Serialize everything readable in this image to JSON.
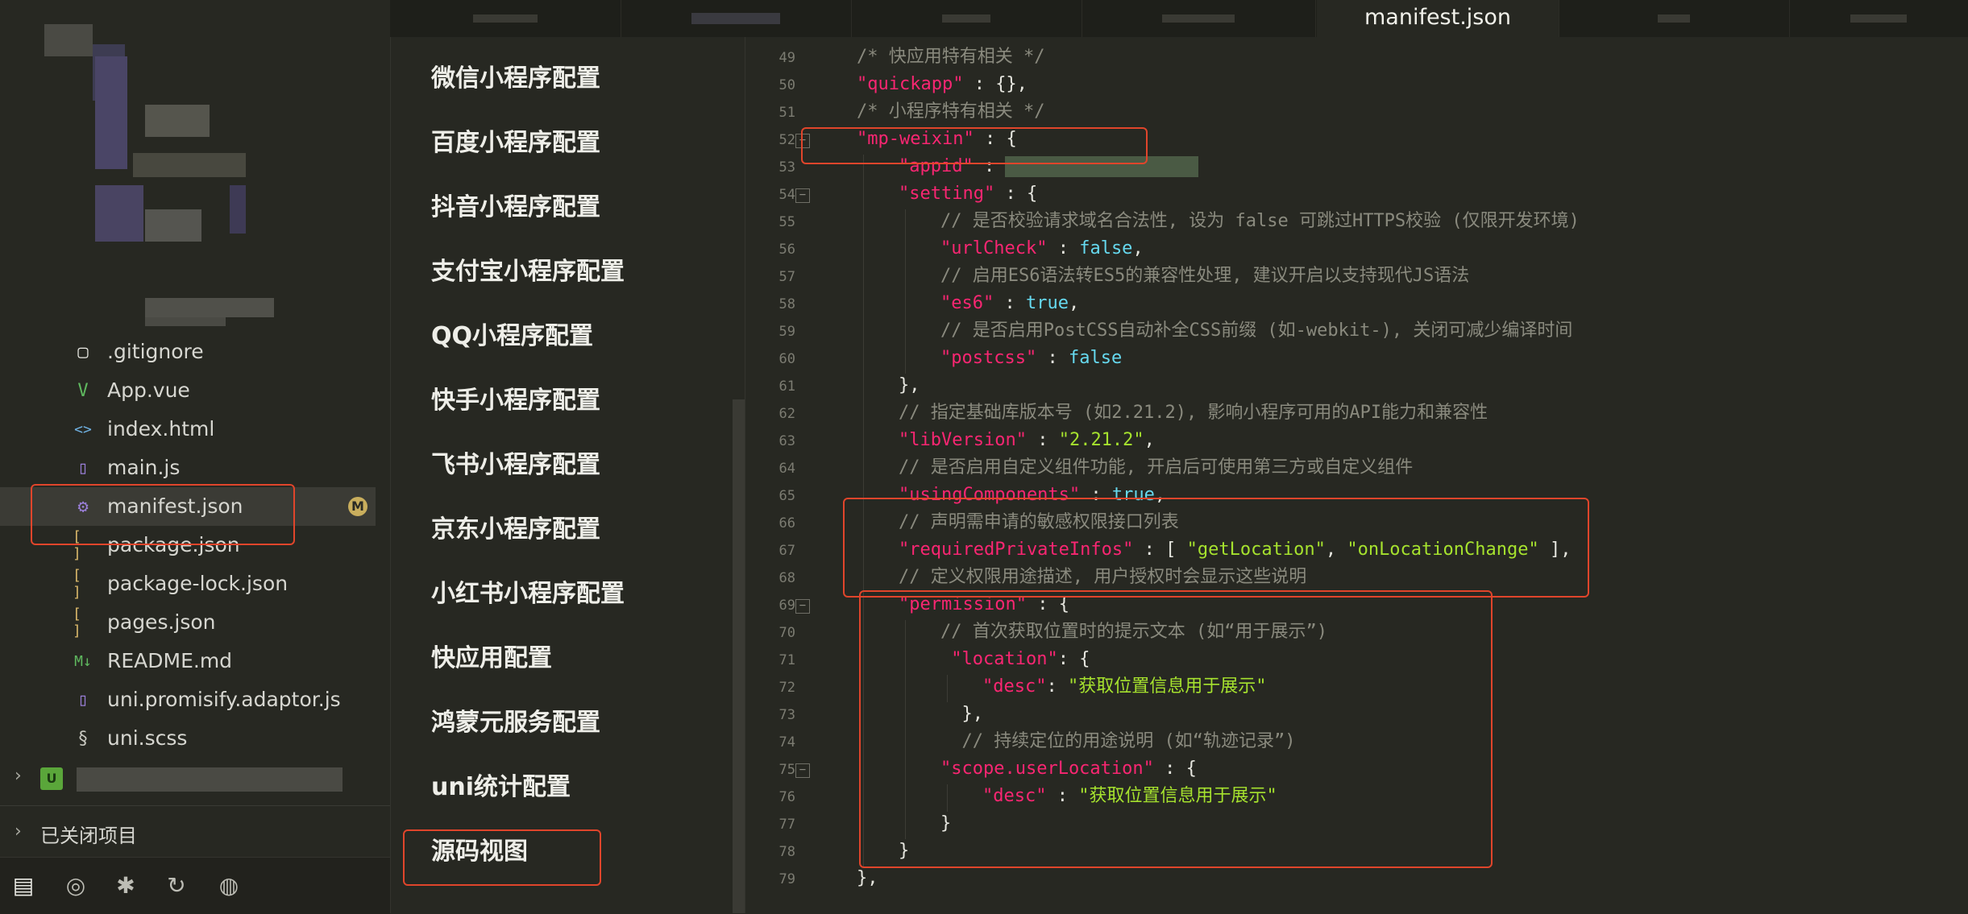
{
  "file_tree": {
    "items": [
      {
        "name": ".gitignore",
        "icon": "file-icon"
      },
      {
        "name": "App.vue",
        "icon": "vue-file-icon"
      },
      {
        "name": "index.html",
        "icon": "html-file-icon"
      },
      {
        "name": "main.js",
        "icon": "js-file-icon"
      },
      {
        "name": "manifest.json",
        "icon": "settings-file-icon",
        "badge": "M"
      },
      {
        "name": "package.json",
        "icon": "json-file-icon"
      },
      {
        "name": "package-lock.json",
        "icon": "json-file-icon"
      },
      {
        "name": "pages.json",
        "icon": "json-file-icon"
      },
      {
        "name": "README.md",
        "icon": "markdown-file-icon"
      },
      {
        "name": "uni.promisify.adaptor.js",
        "icon": "js-file-icon"
      },
      {
        "name": "uni.scss",
        "icon": "scss-file-icon"
      }
    ],
    "project_icon_label": "U",
    "closed_projects_label": "已关闭项目"
  },
  "tabs": {
    "active": "manifest.json"
  },
  "config_nav": {
    "items": [
      "微信小程序配置",
      "百度小程序配置",
      "抖音小程序配置",
      "支付宝小程序配置",
      "QQ小程序配置",
      "快手小程序配置",
      "飞书小程序配置",
      "京东小程序配置",
      "小红书小程序配置",
      "快应用配置",
      "鸿蒙元服务配置",
      "uni统计配置",
      "源码视图"
    ]
  },
  "editor": {
    "lines": [
      {
        "n": "49",
        "indent": 0,
        "parts": [
          [
            "c-com",
            "/* 快应用特有相关 */"
          ]
        ]
      },
      {
        "n": "50",
        "indent": 0,
        "parts": [
          [
            "c-key",
            "\"quickapp\""
          ],
          [
            "",
            " : {},"
          ]
        ]
      },
      {
        "n": "51",
        "indent": 0,
        "parts": [
          [
            "c-com",
            "/* 小程序特有相关 */"
          ]
        ]
      },
      {
        "n": "52",
        "indent": 0,
        "fold": true,
        "parts": [
          [
            "c-key",
            "\"mp-weixin\""
          ],
          [
            "",
            " : {"
          ]
        ]
      },
      {
        "n": "53",
        "indent": 1,
        "parts": [
          [
            "c-key",
            "\"appid\""
          ],
          [
            "",
            " : "
          ]
        ]
      },
      {
        "n": "54",
        "indent": 1,
        "fold": true,
        "parts": [
          [
            "c-key",
            "\"setting\""
          ],
          [
            "",
            " : {"
          ]
        ]
      },
      {
        "n": "55",
        "indent": 2,
        "parts": [
          [
            "c-com",
            "// 是否校验请求域名合法性, 设为 false 可跳过HTTPS校验 (仅限开发环境)"
          ]
        ]
      },
      {
        "n": "56",
        "indent": 2,
        "parts": [
          [
            "c-key",
            "\"urlCheck\""
          ],
          [
            "",
            " : "
          ],
          [
            "c-bool",
            "false"
          ],
          [
            "",
            ","
          ]
        ]
      },
      {
        "n": "57",
        "indent": 2,
        "parts": [
          [
            "c-com",
            "// 启用ES6语法转ES5的兼容性处理, 建议开启以支持现代JS语法"
          ]
        ]
      },
      {
        "n": "58",
        "indent": 2,
        "parts": [
          [
            "c-key",
            "\"es6\""
          ],
          [
            "",
            " : "
          ],
          [
            "c-bool",
            "true"
          ],
          [
            "",
            ","
          ]
        ]
      },
      {
        "n": "59",
        "indent": 2,
        "parts": [
          [
            "c-com",
            "// 是否启用PostCSS自动补全CSS前缀 (如-webkit-), 关闭可减少编译时间"
          ]
        ]
      },
      {
        "n": "60",
        "indent": 2,
        "parts": [
          [
            "c-key",
            "\"postcss\""
          ],
          [
            "",
            " : "
          ],
          [
            "c-bool",
            "false"
          ]
        ]
      },
      {
        "n": "61",
        "indent": 1,
        "parts": [
          [
            "",
            "},"
          ]
        ]
      },
      {
        "n": "62",
        "indent": 1,
        "parts": [
          [
            "c-com",
            "// 指定基础库版本号 (如2.21.2), 影响小程序可用的API能力和兼容性"
          ]
        ]
      },
      {
        "n": "63",
        "indent": 1,
        "parts": [
          [
            "c-key",
            "\"libVersion\""
          ],
          [
            "",
            " : "
          ],
          [
            "c-str",
            "\"2.21.2\""
          ],
          [
            "",
            ","
          ]
        ]
      },
      {
        "n": "64",
        "indent": 1,
        "parts": [
          [
            "c-com",
            "// 是否启用自定义组件功能, 开启后可使用第三方或自定义组件"
          ]
        ]
      },
      {
        "n": "65",
        "indent": 1,
        "parts": [
          [
            "c-key",
            "\"usingComponents\""
          ],
          [
            "",
            " : "
          ],
          [
            "c-bool",
            "true"
          ],
          [
            "",
            ","
          ]
        ]
      },
      {
        "n": "66",
        "indent": 1,
        "parts": [
          [
            "c-com",
            "// 声明需申请的敏感权限接口列表"
          ]
        ]
      },
      {
        "n": "67",
        "indent": 1,
        "parts": [
          [
            "c-key",
            "\"requiredPrivateInfos\""
          ],
          [
            "",
            " : [ "
          ],
          [
            "c-str",
            "\"getLocation\""
          ],
          [
            "",
            ", "
          ],
          [
            "c-str",
            "\"onLocationChange\""
          ],
          [
            "",
            " ],"
          ]
        ]
      },
      {
        "n": "68",
        "indent": 1,
        "parts": [
          [
            "c-com",
            "// 定义权限用途描述, 用户授权时会显示这些说明"
          ]
        ]
      },
      {
        "n": "69",
        "indent": 1,
        "fold": true,
        "parts": [
          [
            "c-key",
            "\"permission\""
          ],
          [
            "",
            " : {"
          ]
        ]
      },
      {
        "n": "70",
        "indent": 2,
        "parts": [
          [
            "c-com",
            "// 首次获取位置时的提示文本 (如“用于展示”)"
          ]
        ]
      },
      {
        "n": "71",
        "indent": 2,
        "extra": " ",
        "parts": [
          [
            "c-key",
            "\"location\""
          ],
          [
            "",
            ": {"
          ]
        ]
      },
      {
        "n": "72",
        "indent": 3,
        "parts": [
          [
            "c-key",
            "\"desc\""
          ],
          [
            "",
            ": "
          ],
          [
            "c-str",
            "\"获取位置信息用于展示\""
          ]
        ]
      },
      {
        "n": "73",
        "indent": 2,
        "extra": "  ",
        "parts": [
          [
            "",
            "},"
          ]
        ]
      },
      {
        "n": "74",
        "indent": 2,
        "extra": "  ",
        "parts": [
          [
            "c-com",
            "// 持续定位的用途说明 (如“轨迹记录”)"
          ]
        ]
      },
      {
        "n": "75",
        "indent": 2,
        "fold": true,
        "parts": [
          [
            "c-key",
            "\"scope.userLocation\""
          ],
          [
            "",
            " : {"
          ]
        ]
      },
      {
        "n": "76",
        "indent": 3,
        "parts": [
          [
            "c-key",
            "\"desc\""
          ],
          [
            "",
            " : "
          ],
          [
            "c-str",
            "\"获取位置信息用于展示\""
          ]
        ]
      },
      {
        "n": "77",
        "indent": 2,
        "parts": [
          [
            "",
            "}"
          ]
        ]
      },
      {
        "n": "78",
        "indent": 1,
        "parts": [
          [
            "",
            "}"
          ]
        ]
      },
      {
        "n": "79",
        "indent": 0,
        "parts": [
          [
            "",
            "},"
          ]
        ]
      }
    ]
  },
  "colors": {
    "background": "#272822",
    "keyword": "#f92672",
    "string": "#a6e22e",
    "boolean": "#66d9ef",
    "comment": "#8a8a7e",
    "highlight": "#e0452b"
  }
}
